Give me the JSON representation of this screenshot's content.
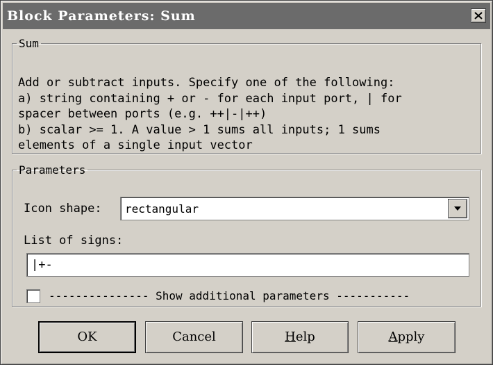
{
  "window": {
    "title": "Block Parameters: Sum"
  },
  "description": {
    "group_label": "Sum",
    "lines": [
      "Add or subtract inputs.  Specify one of the following:",
      "a) string containing + or - for each input port, | for",
      "spacer between ports (e.g. ++|-|++)",
      "b) scalar >= 1. A value > 1 sums all inputs; 1 sums",
      "elements of a single input vector"
    ]
  },
  "parameters": {
    "group_label": "Parameters",
    "icon_shape_label": "Icon shape:",
    "icon_shape_value": "rectangular",
    "list_of_signs_label": "List of signs:",
    "list_of_signs_value": "|+-",
    "show_additional_label": "--------------- Show additional parameters -----------",
    "show_additional_checked": false
  },
  "buttons": {
    "ok": "OK",
    "cancel": "Cancel",
    "help": "Help",
    "apply": "Apply"
  },
  "icons": {
    "close": "close-icon",
    "dropdown": "chevron-down-icon"
  },
  "colors": {
    "titlebar": "#6b6b6b",
    "face": "#d4d0c8"
  }
}
